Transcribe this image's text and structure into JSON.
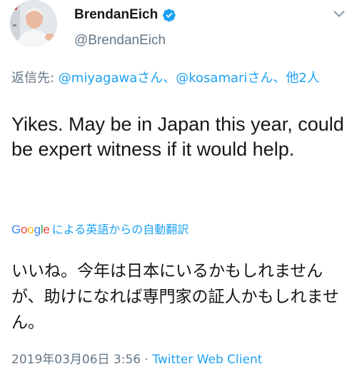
{
  "author": {
    "display_name": "BrendanEich",
    "handle": "@BrendanEich",
    "verified_icon": "verified-badge-icon",
    "avatar_icon": "avatar-photo"
  },
  "reply": {
    "prefix": "返信先: ",
    "mention1": "@miyagawa",
    "suffix1": "さん、",
    "mention2": "@kosamari",
    "suffix2": "さん、",
    "others": "他2人"
  },
  "tweet": {
    "text": "Yikes. May be in Japan this year, could be expert witness if it would help."
  },
  "translation": {
    "google_letters": [
      "G",
      "o",
      "o",
      "g",
      "l",
      "e"
    ],
    "google_colors": [
      "#4285f4",
      "#ea4335",
      "#fbbc05",
      "#4285f4",
      "#34a853",
      "#ea4335"
    ],
    "label": "による英語からの自動翻訳",
    "text": "いいね。今年は日本にいるかもしれませんが、助けになれば専門家の証人かもしれません。"
  },
  "meta": {
    "datetime": "2019年03月06日 3:56",
    "separator": " · ",
    "source": "Twitter Web Client"
  },
  "colors": {
    "link": "#1da1f2",
    "secondary": "#657786",
    "text": "#14171a"
  }
}
